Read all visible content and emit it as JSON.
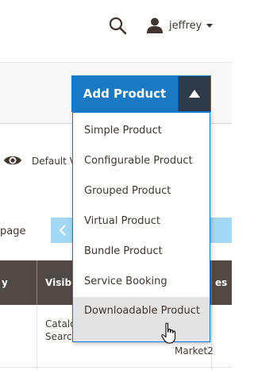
{
  "header": {
    "search_icon": "search-icon",
    "user_icon": "user-icon",
    "username": "jeffrey"
  },
  "actions": {
    "add_product_label": "Add Product",
    "toggle_icon": "triangle-up-icon",
    "accent_color": "#1979c3",
    "toggle_color": "#2f3a4a"
  },
  "dropdown": {
    "items": [
      {
        "label": "Simple Product"
      },
      {
        "label": "Configurable Product"
      },
      {
        "label": "Grouped Product"
      },
      {
        "label": "Virtual Product"
      },
      {
        "label": "Bundle Product"
      },
      {
        "label": "Service Booking"
      },
      {
        "label": "Downloadable Product",
        "hovered": true
      }
    ],
    "border_color": "#007bdb",
    "hover_color": "#e3e3e3"
  },
  "grid": {
    "view_icon": "eye-icon",
    "default_view_label": "Default V",
    "page_label": "page",
    "columns": [
      {
        "label": "y"
      },
      {
        "label": "Visibi"
      },
      {
        "label": "es"
      }
    ],
    "header_color": "#514943",
    "rows": [
      {
        "visibility_line1": "Catalo",
        "visibility_line2": "Searc",
        "websites_line1": "e,",
        "websites_line2": "Market2"
      }
    ]
  }
}
